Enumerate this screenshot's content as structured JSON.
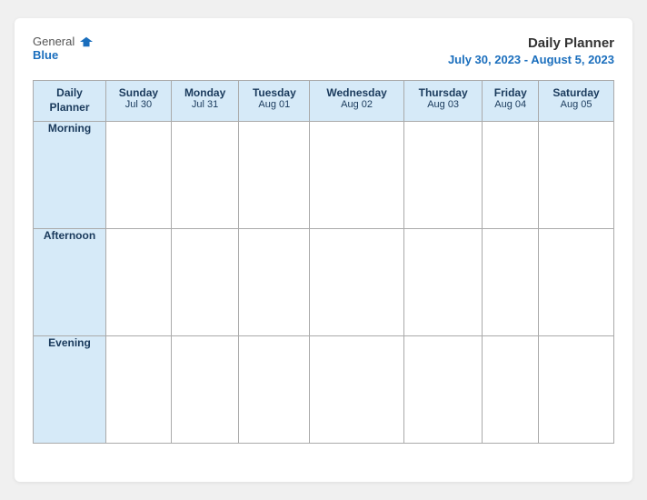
{
  "header": {
    "logo": {
      "general": "General",
      "blue": "Blue",
      "icon_color": "#1a6ebd"
    },
    "title": "Daily Planner",
    "date_range": "July 30, 2023 - August 5, 2023"
  },
  "table": {
    "columns": [
      {
        "day": "Daily Planner",
        "date": ""
      },
      {
        "day": "Sunday",
        "date": "Jul 30"
      },
      {
        "day": "Monday",
        "date": "Jul 31"
      },
      {
        "day": "Tuesday",
        "date": "Aug 01"
      },
      {
        "day": "Wednesday",
        "date": "Aug 02"
      },
      {
        "day": "Thursday",
        "date": "Aug 03"
      },
      {
        "day": "Friday",
        "date": "Aug 04"
      },
      {
        "day": "Saturday",
        "date": "Aug 05"
      }
    ],
    "rows": [
      {
        "label": "Morning"
      },
      {
        "label": "Afternoon"
      },
      {
        "label": "Evening"
      }
    ]
  }
}
